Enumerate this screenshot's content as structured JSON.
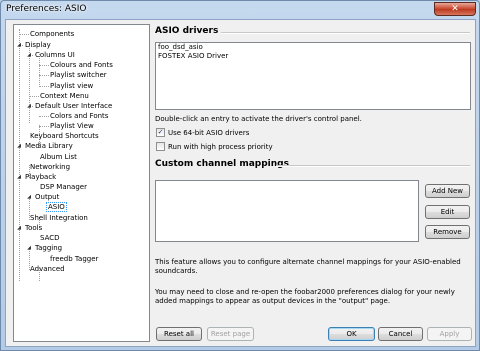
{
  "window": {
    "title": "Preferences: ASIO",
    "close_glyph": "✕"
  },
  "tree": {
    "items": [
      {
        "label": "Components"
      },
      {
        "label": "Display"
      },
      {
        "label": "Columns UI"
      },
      {
        "label": "Colours and Fonts"
      },
      {
        "label": "Playlist switcher"
      },
      {
        "label": "Playlist view"
      },
      {
        "label": "Context Menu"
      },
      {
        "label": "Default User Interface"
      },
      {
        "label": "Colors and Fonts"
      },
      {
        "label": "Playlist View"
      },
      {
        "label": "Keyboard Shortcuts"
      },
      {
        "label": "Media Library"
      },
      {
        "label": "Album List"
      },
      {
        "label": "Networking"
      },
      {
        "label": "Playback"
      },
      {
        "label": "DSP Manager"
      },
      {
        "label": "Output"
      },
      {
        "label": "ASIO"
      },
      {
        "label": "Shell Integration"
      },
      {
        "label": "Tools"
      },
      {
        "label": "SACD"
      },
      {
        "label": "Tagging"
      },
      {
        "label": "freedb Tagger"
      },
      {
        "label": "Advanced"
      }
    ],
    "expander_glyph": "◢"
  },
  "asio": {
    "title": "ASIO drivers",
    "drivers": [
      "foo_dsd_asio",
      "FOSTEX ASIO Driver"
    ],
    "hint": "Double-click an entry to activate the driver's control panel.",
    "use64_label": "Use 64-bit ASIO drivers",
    "use64_checked": "✓",
    "high_priority_label": "Run with high process priority",
    "high_priority_checked": ""
  },
  "mappings": {
    "title": "Custom channel mappings",
    "add_label": "Add New",
    "edit_label": "Edit",
    "remove_label": "Remove",
    "info1_line1": "This feature allows you to configure alternate channel mappings for your ASIO-enabled",
    "info1_line2": "soundcards.",
    "info2_line1": "You may need to close and re-open the foobar2000 preferences dialog for your newly",
    "info2_line2": "added mappings to appear as output devices in the \"output\" page."
  },
  "footer": {
    "reset_all": "Reset all",
    "reset_page": "Reset page",
    "ok": "OK",
    "cancel": "Cancel",
    "apply": "Apply"
  }
}
